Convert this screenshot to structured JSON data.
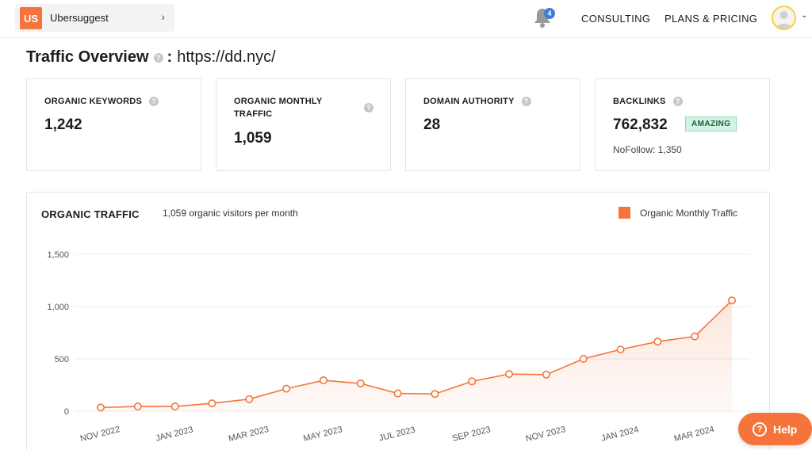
{
  "header": {
    "logo_text": "US",
    "project_name": "Ubersuggest",
    "project_chevron": "›",
    "notification_count": "4",
    "nav": {
      "consulting": "CONSULTING",
      "plans": "PLANS & PRICING"
    },
    "avatar_caret": "⌄"
  },
  "page": {
    "title": "Traffic Overview",
    "info_glyph": "?",
    "colon": ":",
    "url": "https://dd.nyc/"
  },
  "cards": {
    "organic_keywords": {
      "label": "ORGANIC KEYWORDS",
      "value": "1,242"
    },
    "organic_monthly_traffic": {
      "label": "ORGANIC MONTHLY TRAFFIC",
      "value": "1,059"
    },
    "domain_authority": {
      "label": "DOMAIN AUTHORITY",
      "value": "28"
    },
    "backlinks": {
      "label": "BACKLINKS",
      "value": "762,832",
      "badge": "AMAZING",
      "nofollow": "NoFollow: 1,350"
    }
  },
  "chart_panel": {
    "title": "ORGANIC TRAFFIC",
    "subtitle": "1,059 organic visitors per month",
    "legend_label": "Organic Monthly Traffic"
  },
  "help": {
    "label": "Help",
    "icon_glyph": "?"
  },
  "colors": {
    "accent": "#f4743b",
    "badge_bg": "#d2f4e3",
    "avatar_ring": "#f7d33c",
    "bell_badge": "#3b7ddd"
  },
  "chart_data": {
    "type": "area",
    "series": [
      {
        "name": "Organic Monthly Traffic",
        "values": [
          35,
          45,
          45,
          75,
          115,
          215,
          295,
          265,
          170,
          165,
          285,
          355,
          350,
          500,
          590,
          665,
          715,
          1059
        ]
      }
    ],
    "x_tick_labels": [
      "NOV 2022",
      "JAN 2023",
      "MAR 2023",
      "MAY 2023",
      "JUL 2023",
      "SEP 2023",
      "NOV 2023",
      "JAN 2024",
      "MAR 2024"
    ],
    "y_tick_labels": [
      "0",
      "500",
      "1,000",
      "1,500"
    ],
    "y_ticks": [
      0,
      500,
      1000,
      1500
    ],
    "ylim": [
      0,
      1500
    ],
    "grid": true
  }
}
